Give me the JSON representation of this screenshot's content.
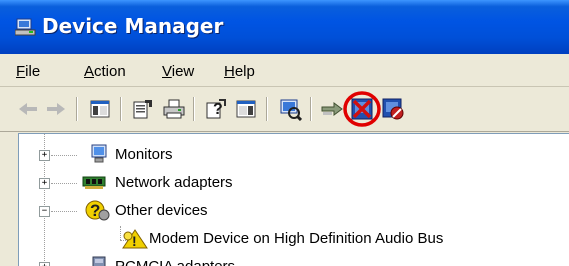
{
  "window": {
    "title": "Device Manager"
  },
  "menu": [
    {
      "label": "File",
      "underline": "F",
      "rest": "ile"
    },
    {
      "label": "Action",
      "underline": "A",
      "rest": "ction"
    },
    {
      "label": "View",
      "underline": "V",
      "rest": "iew"
    },
    {
      "label": "Help",
      "underline": "H",
      "rest": "elp"
    }
  ],
  "toolbar": {
    "buttons": [
      "back-icon",
      "forward-icon",
      "show-hide-console-tree-icon",
      "properties-icon",
      "print-icon",
      "help-icon",
      "action-pane-icon",
      "scan-hardware-icon",
      "update-driver-icon",
      "uninstall-icon",
      "disable-icon"
    ],
    "highlight_color": "#e00000"
  },
  "tree": {
    "items": [
      {
        "label": "Monitors",
        "expander": "+"
      },
      {
        "label": "Network adapters",
        "expander": "+"
      },
      {
        "label": "Other devices",
        "expander": "−"
      },
      {
        "label": "Modem Device on High Definition Audio Bus"
      },
      {
        "label": "PCMCIA adapters",
        "expander": "+"
      }
    ]
  }
}
